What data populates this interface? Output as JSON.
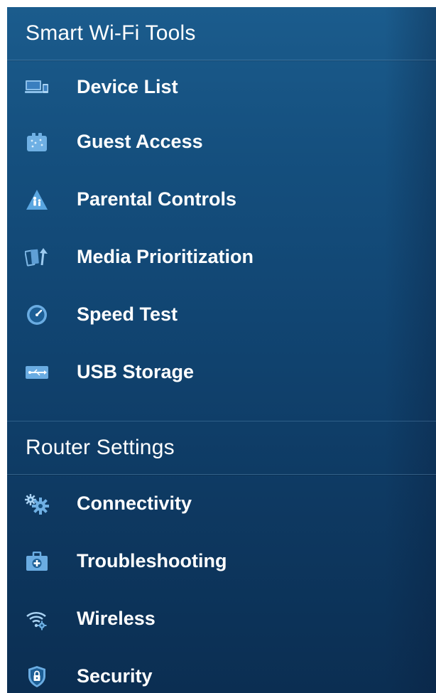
{
  "sections": [
    {
      "title": "Smart Wi-Fi Tools",
      "items": [
        {
          "label": "Device List",
          "icon": "device-list-icon"
        },
        {
          "label": "Guest Access",
          "icon": "guest-access-icon"
        },
        {
          "label": "Parental Controls",
          "icon": "parental-controls-icon"
        },
        {
          "label": "Media Prioritization",
          "icon": "media-prioritization-icon"
        },
        {
          "label": "Speed Test",
          "icon": "speed-test-icon"
        },
        {
          "label": "USB Storage",
          "icon": "usb-storage-icon"
        }
      ]
    },
    {
      "title": "Router Settings",
      "items": [
        {
          "label": "Connectivity",
          "icon": "connectivity-icon"
        },
        {
          "label": "Troubleshooting",
          "icon": "troubleshooting-icon"
        },
        {
          "label": "Wireless",
          "icon": "wireless-icon"
        },
        {
          "label": "Security",
          "icon": "security-icon"
        }
      ]
    }
  ],
  "colors": {
    "panel_top": "#1b5c8d",
    "panel_bottom": "#0b2e52",
    "text": "#ffffff",
    "icon_fill": "#7fb8e6"
  }
}
